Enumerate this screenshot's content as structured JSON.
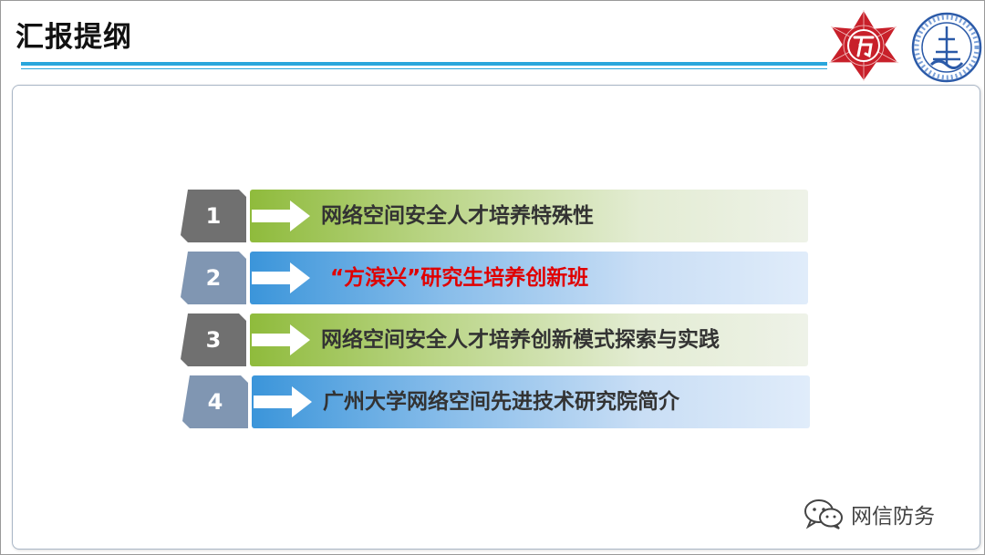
{
  "slide": {
    "title": "汇报提纲"
  },
  "colors": {
    "title_rule": "#29a6dc",
    "tab_dark": "#707070",
    "tab_slate": "#8096b2",
    "bar_green": "#8fbb3c",
    "bar_blue": "#3b95da",
    "highlight_red": "#e00000"
  },
  "logos": {
    "left": "university-star-emblem",
    "right": "institute-round-seal"
  },
  "outline": {
    "items": [
      {
        "number": "1",
        "label": "网络空间安全人才培养特殊性",
        "style": "green"
      },
      {
        "number": "2",
        "label": "“方滨兴”研究生培养创新班",
        "style": "blue"
      },
      {
        "number": "3",
        "label": "网络空间安全人才培养创新模式探索与实践",
        "style": "green"
      },
      {
        "number": "4",
        "label": "广州大学网络空间先进技术研究院简介",
        "style": "blue"
      }
    ]
  },
  "watermark": {
    "icon": "wechat-icon",
    "text": "网信防务"
  }
}
